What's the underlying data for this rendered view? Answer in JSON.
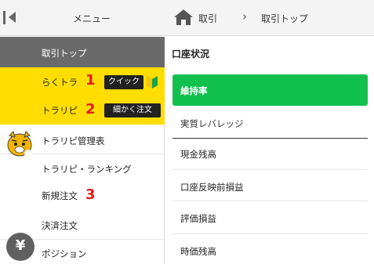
{
  "topbar": {
    "menu_label": "メニュー",
    "breadcrumb": {
      "level1": "取引",
      "level2": "取引トップ"
    }
  },
  "sidebar": {
    "active": {
      "label": "取引トップ"
    },
    "rakutora": {
      "label": "らくトラ",
      "number": "1",
      "tag": "クイック"
    },
    "torarib": {
      "label": "トラリピ",
      "number": "2",
      "tag": "細かく注文"
    },
    "kanri": {
      "label": "トラリピ管理表"
    },
    "ranking": {
      "label": "トラリピ・ランキング"
    },
    "shinki": {
      "label": "新規注文",
      "number": "3"
    },
    "kessai": {
      "label": "決済注文"
    },
    "position": {
      "label": "ポジション"
    },
    "yen_symbol": "¥"
  },
  "main": {
    "title": "口座状況",
    "items": [
      {
        "label": "維持率",
        "active": true
      },
      {
        "label": "実質レバレッジ"
      },
      {
        "label": "現金残高"
      },
      {
        "label": "口座反映前損益"
      },
      {
        "label": "評価損益"
      },
      {
        "label": "時価残高"
      }
    ]
  },
  "colors": {
    "active_green": "#12c04e",
    "highlight_yellow": "#ffdd00",
    "active_sidebar": "#6a6a6a",
    "number_red": "#e51a1a"
  }
}
